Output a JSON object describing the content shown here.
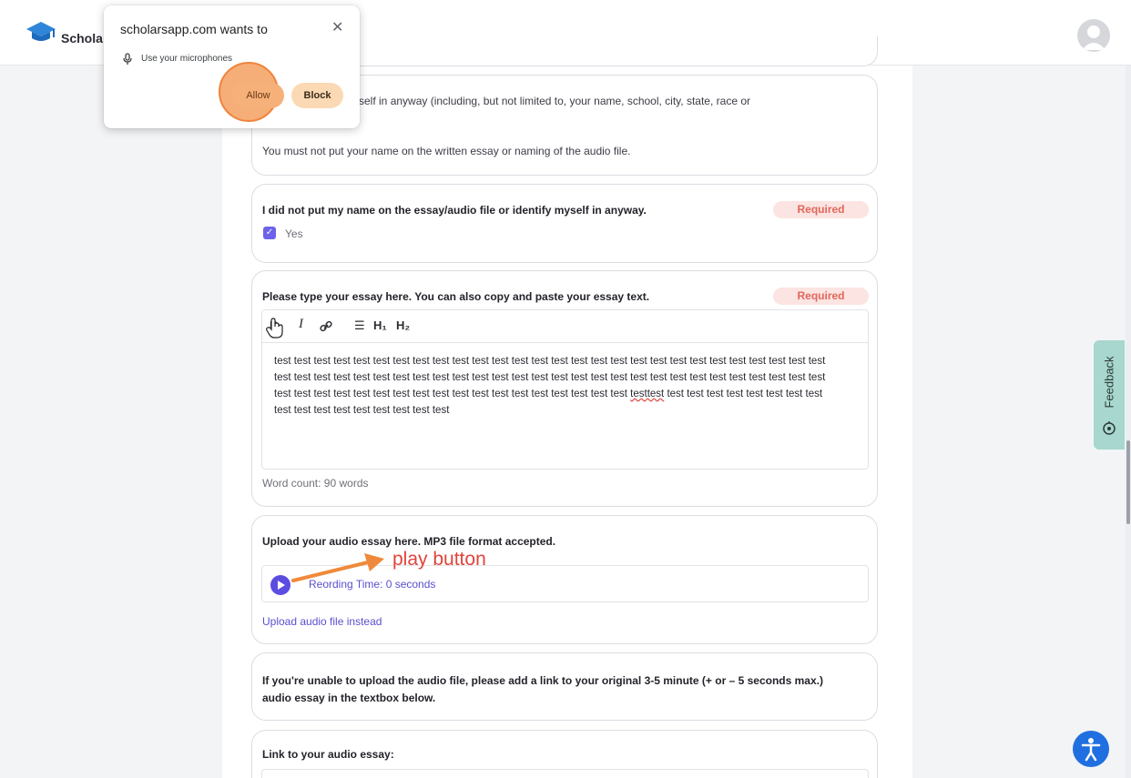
{
  "header": {
    "logo_text": "Schola",
    "avatar_icon": "user-avatar-icon"
  },
  "permission_prompt": {
    "title": "scholarsapp.com wants to",
    "permission_text": "Use your microphones",
    "allow_label": "Allow",
    "block_label": "Block",
    "close_icon": "close-icon",
    "mic_icon": "microphone-icon"
  },
  "rules_card": {
    "line1": "fy yourself in anyway (including, but not limited to, your name, school, city, state, race or",
    "line2": "You must not put your name on the written essay or naming of the audio file."
  },
  "confirm_card": {
    "question": "I did not put my name on the essay/audio file or identify myself in anyway.",
    "required_label": "Required",
    "checkbox_label": "Yes",
    "checked": true
  },
  "essay_card": {
    "question": "Please type your essay here. You can also copy and paste your essay text.",
    "required_label": "Required",
    "toolbar": {
      "h1_label": "H₁",
      "h2_label": "H₂",
      "bold_icon": "bold-icon",
      "italic_icon": "italic-icon",
      "link_icon": "link-icon",
      "align_icon": "align-icon"
    },
    "lines": [
      "test test test test test test test test test test test test test test test test test test test test test test test test test test test test",
      "test test test test test test test test test test test test test test test test test test test test test test test test test test test test",
      "test test test test test test test test test test test test test test test test test test",
      "test test test test test test test test test"
    ],
    "line3_misspelled": "testtest",
    "line3_tail": " test test test test test test test test",
    "word_count": "Word count: 90 words"
  },
  "audio_card": {
    "question": "Upload your audio essay here. MP3 file format accepted.",
    "recording_status": "Reording Time: 0 seconds",
    "upload_link": "Upload audio file instead",
    "play_icon": "play-icon"
  },
  "annotation": {
    "text": "play button",
    "color": "#e0443b",
    "arrow_color": "#ef8a3c"
  },
  "link_info_card": {
    "line1": "If you're unable to upload the audio file, please add a link to your original 3-5 minute (+ or – 5 seconds max.)",
    "line2": "audio essay in the textbox below."
  },
  "link_card": {
    "label": "Link to your audio essay:"
  },
  "feedback_tab": {
    "label": "Feedback",
    "icon": "feedback-icon"
  },
  "accessibility": {
    "icon": "accessibility-icon"
  },
  "colors": {
    "accent": "#5b4de0",
    "required_bg": "#fbe4e1",
    "required_text": "#e2665b",
    "feedback_bg": "#a7d7ce",
    "allow_highlight": "#f39c5a"
  }
}
